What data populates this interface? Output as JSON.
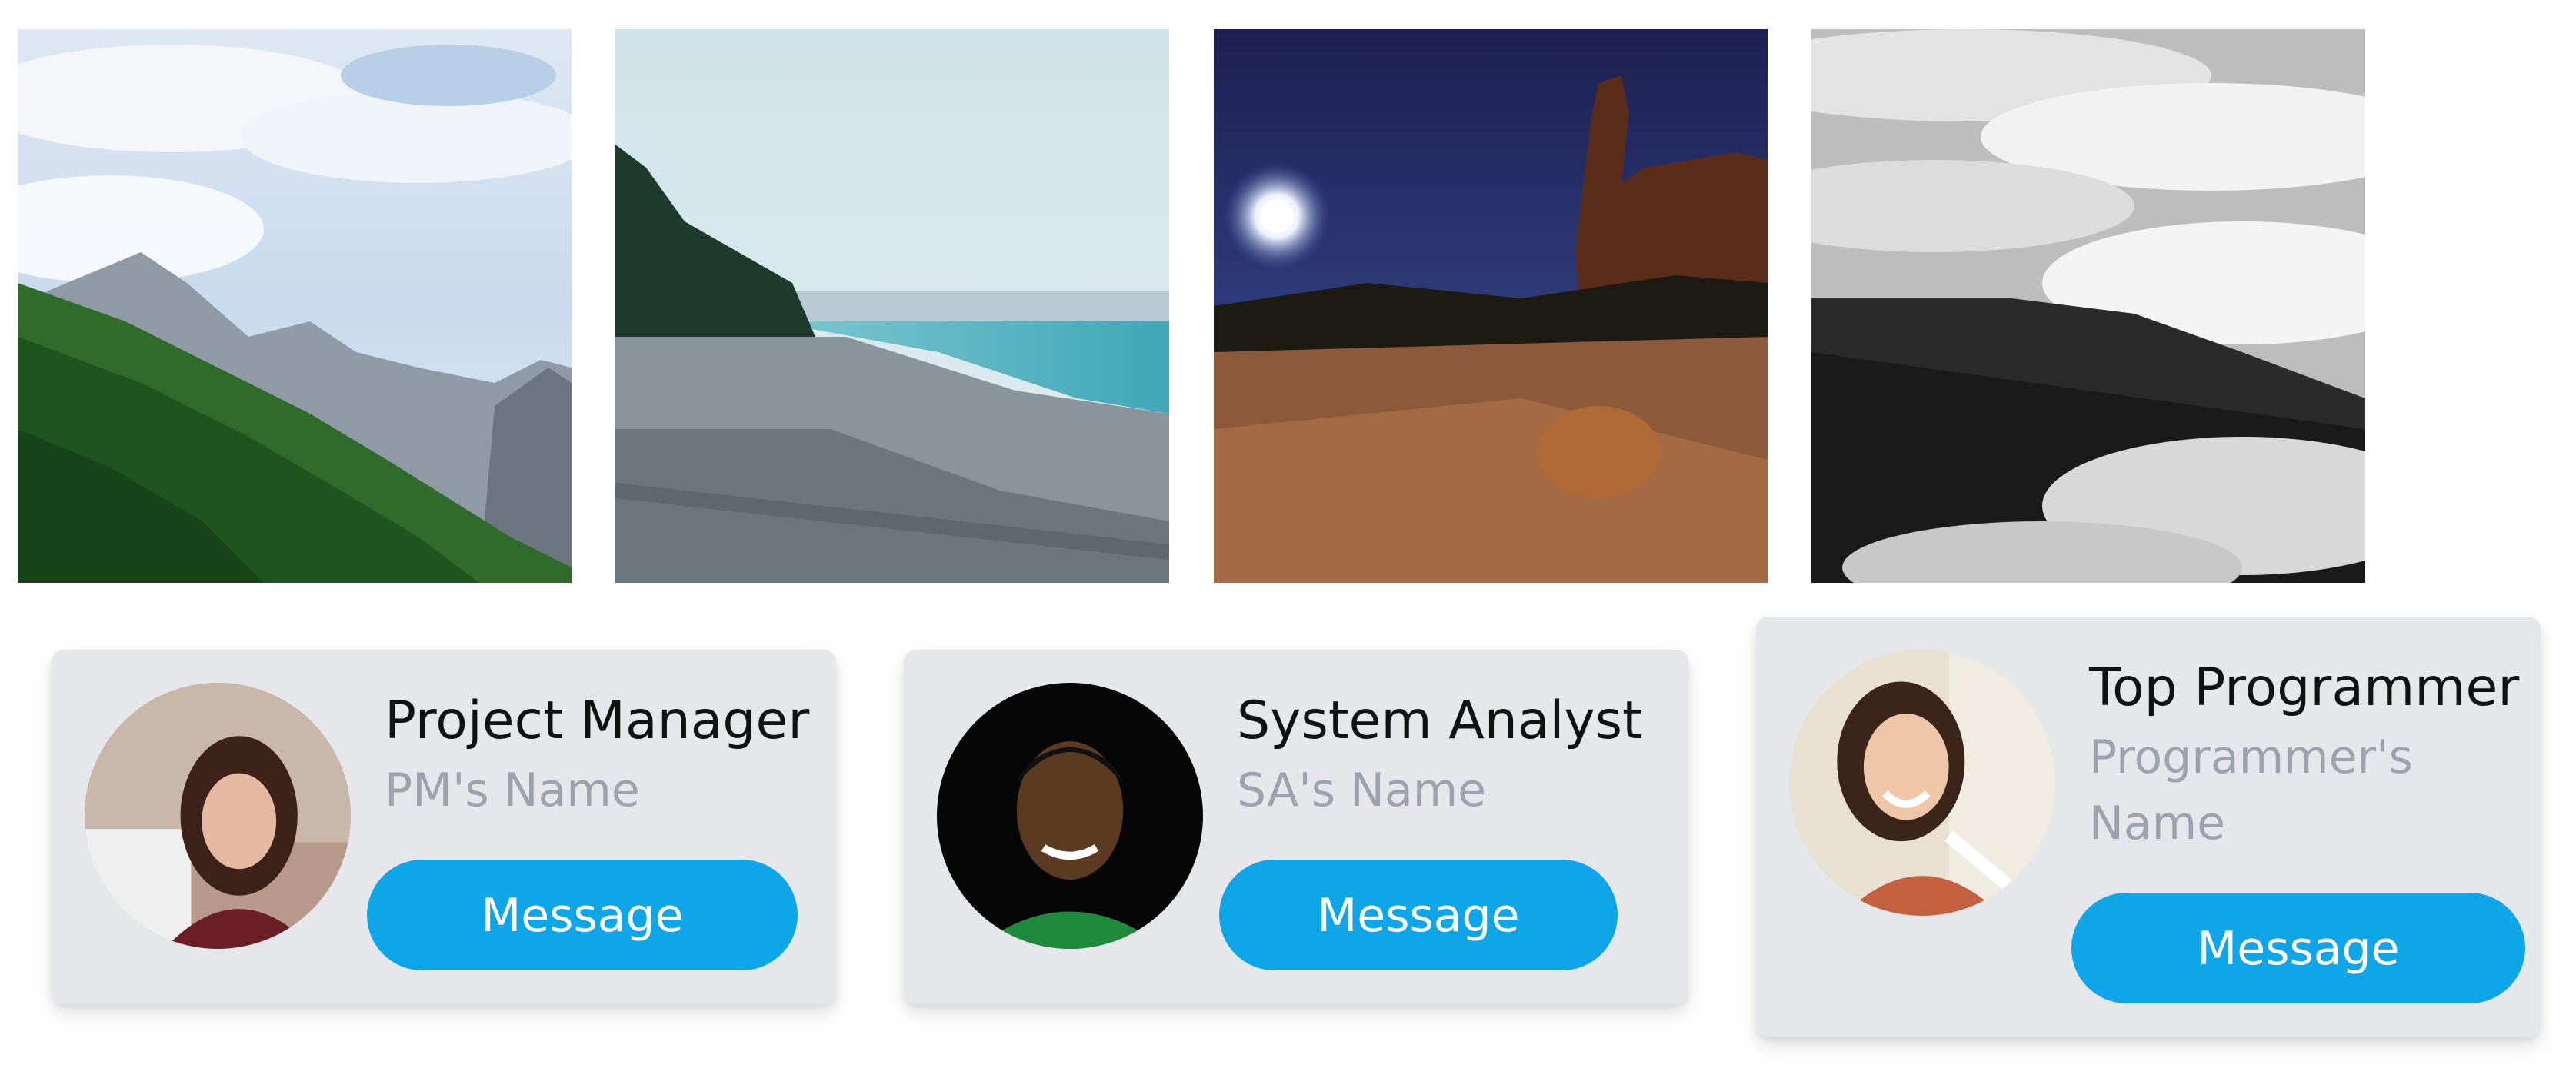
{
  "gallery": {
    "photos": [
      {
        "subject": "forested mountain slope under cloudy sky"
      },
      {
        "subject": "pebble beach with turquoise sea"
      },
      {
        "subject": "desert rock formation under moonlit night sky"
      },
      {
        "subject": "black and white sea of clouds over hills"
      }
    ]
  },
  "team": {
    "cards": [
      {
        "role": "Project Manager",
        "name": "PM's Name",
        "button_label": "Message"
      },
      {
        "role": "System Analyst",
        "name": "SA's Name",
        "button_label": "Message"
      },
      {
        "role": "Top Programmer",
        "name": "Programmer's Name",
        "button_label": "Message"
      }
    ]
  },
  "colors": {
    "card_bg": "#e5e7eb",
    "accent": "#0ea5e9",
    "title_text": "#111111",
    "subtitle_text": "#9ca3af"
  }
}
